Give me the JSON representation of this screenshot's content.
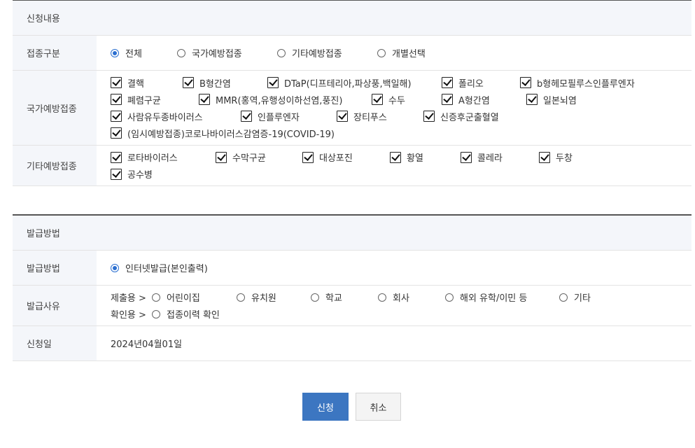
{
  "application": {
    "header": "신청내용",
    "type_label": "접종구분",
    "type_options": [
      "전체",
      "국가예방접종",
      "기타예방접종",
      "개별선택"
    ],
    "type_selected": "전체",
    "national_label": "국가예방접종",
    "national_items": [
      [
        "결핵",
        "B형간염",
        "DTaP(디프테리아,파상풍,백일해)",
        "폴리오",
        "b형헤모필루스인플루엔자"
      ],
      [
        "폐렴구균",
        "MMR(홍역,유행성이하선염,풍진)",
        "수두",
        "A형간염",
        "일본뇌염"
      ],
      [
        "사람유두종바이러스",
        "인플루엔자",
        "장티푸스",
        "신증후군출혈열"
      ],
      [
        "(임시예방접종)코로나바이러스감염증-19(COVID-19)"
      ]
    ],
    "other_label": "기타예방접종",
    "other_items": [
      [
        "로타바이러스",
        "수막구균",
        "대상포진",
        "황열",
        "콜레라",
        "두창"
      ],
      [
        "공수병"
      ]
    ]
  },
  "issuance": {
    "header": "발급방법",
    "method_label": "발급방법",
    "method_option": "인터넷발급(본인출력)",
    "reason_label": "발급사유",
    "submit_prefix": "제출용 >",
    "submit_options": [
      "어린이집",
      "유치원",
      "학교",
      "회사",
      "해외 유학/이민 등",
      "기타"
    ],
    "confirm_prefix": "확인용 >",
    "confirm_options": [
      "접종이력 확인"
    ],
    "date_label": "신청일",
    "date_value": "2024년04월01일"
  },
  "buttons": {
    "submit": "신청",
    "cancel": "취소"
  },
  "colors": {
    "accent": "#3c76c1",
    "label_bg": "#f4f6fa",
    "radio_checked": "#2b6fd0"
  }
}
